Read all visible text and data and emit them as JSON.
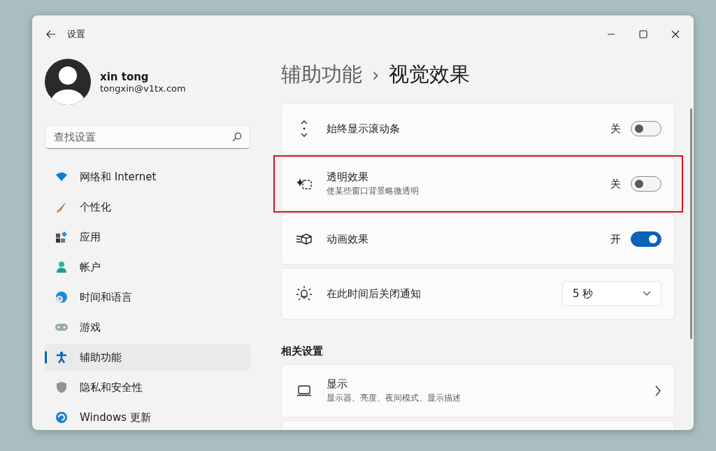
{
  "window": {
    "title": "设置"
  },
  "account": {
    "name": "xin tong",
    "email": "tongxin@v1tx.com"
  },
  "search": {
    "placeholder": "查找设置"
  },
  "sidebar": {
    "items": [
      {
        "label": "网络和 Internet",
        "selected": false
      },
      {
        "label": "个性化",
        "selected": false
      },
      {
        "label": "应用",
        "selected": false
      },
      {
        "label": "帐户",
        "selected": false
      },
      {
        "label": "时间和语言",
        "selected": false
      },
      {
        "label": "游戏",
        "selected": false
      },
      {
        "label": "辅助功能",
        "selected": true
      },
      {
        "label": "隐私和安全性",
        "selected": false
      },
      {
        "label": "Windows 更新",
        "selected": false
      }
    ]
  },
  "breadcrumb": {
    "parent": "辅助功能",
    "separator": "›",
    "current": "视觉效果"
  },
  "settings": [
    {
      "kind": "toggle",
      "title": "始终显示滚动条",
      "state_label": "关",
      "on": false,
      "highlighted": false
    },
    {
      "kind": "toggle",
      "title": "透明效果",
      "description": "使某些窗口背景略微透明",
      "state_label": "关",
      "on": false,
      "highlighted": true
    },
    {
      "kind": "toggle",
      "title": "动画效果",
      "state_label": "开",
      "on": true,
      "highlighted": false
    },
    {
      "kind": "dropdown",
      "title": "在此时间后关闭通知",
      "value": "5 秒",
      "highlighted": false
    }
  ],
  "related": {
    "heading": "相关设置",
    "items": [
      {
        "kind": "link",
        "title": "显示",
        "description": "显示器、亮度、夜间模式、显示描述"
      }
    ]
  }
}
